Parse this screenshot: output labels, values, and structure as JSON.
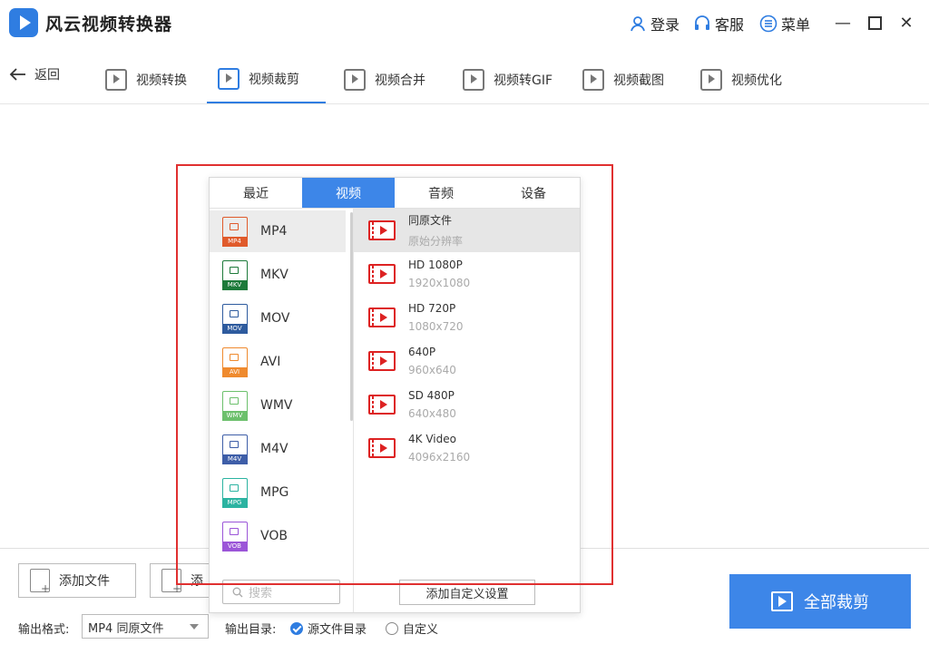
{
  "app": {
    "title": "风云视频转换器"
  },
  "titlebar": {
    "login": "登录",
    "service": "客服",
    "menu": "菜单"
  },
  "toolbar": {
    "back": "返回",
    "tabs": [
      {
        "label": "视频转换"
      },
      {
        "label": "视频裁剪"
      },
      {
        "label": "视频合并"
      },
      {
        "label": "视频转GIF"
      },
      {
        "label": "视频截图"
      },
      {
        "label": "视频优化"
      }
    ]
  },
  "popup": {
    "tabs": [
      {
        "label": "最近"
      },
      {
        "label": "视频"
      },
      {
        "label": "音频"
      },
      {
        "label": "设备"
      }
    ],
    "formats": [
      {
        "label": "MP4",
        "color": "#e05a2b"
      },
      {
        "label": "MKV",
        "color": "#1d7a3a"
      },
      {
        "label": "MOV",
        "color": "#2e5b9e"
      },
      {
        "label": "AVI",
        "color": "#ef8a2e"
      },
      {
        "label": "WMV",
        "color": "#6cc06c"
      },
      {
        "label": "M4V",
        "color": "#3e5ea8"
      },
      {
        "label": "MPG",
        "color": "#2bb3a1"
      },
      {
        "label": "VOB",
        "color": "#9b55d8"
      }
    ],
    "presets": [
      {
        "name": "同原文件",
        "sub": "原始分辨率"
      },
      {
        "name": "HD 1080P",
        "sub": "1920x1080"
      },
      {
        "name": "HD 720P",
        "sub": "1080x720"
      },
      {
        "name": "640P",
        "sub": "960x640"
      },
      {
        "name": "SD 480P",
        "sub": "640x480"
      },
      {
        "name": "4K Video",
        "sub": "4096x2160"
      }
    ],
    "search_placeholder": "搜索",
    "custom_button": "添加自定义设置"
  },
  "bottom": {
    "add_file": "添加文件",
    "add_folder_partial": "添",
    "output_format_label": "输出格式:",
    "output_format_value": "MP4 同原文件",
    "output_dir_label": "输出目录:",
    "radio_source": "源文件目录",
    "radio_custom": "自定义",
    "start_button": "全部裁剪"
  }
}
